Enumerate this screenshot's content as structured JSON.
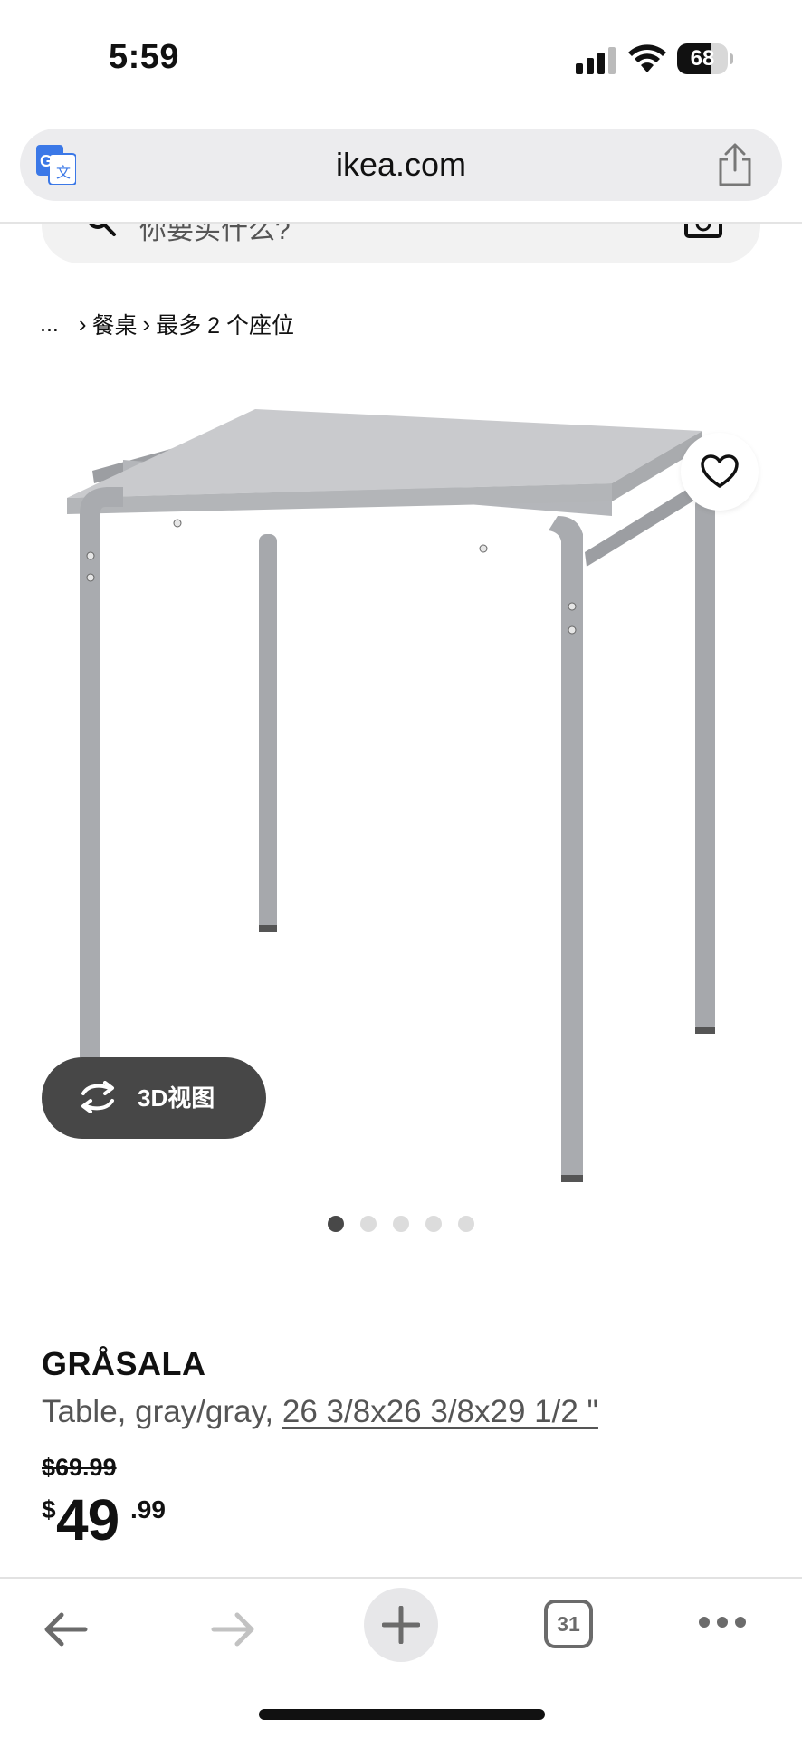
{
  "status_bar": {
    "time": "5:59",
    "battery": "68",
    "battery_level_percent": 68
  },
  "browser": {
    "url": "ikea.com",
    "tab_count": "31"
  },
  "search": {
    "placeholder": "你要买什么?"
  },
  "breadcrumb": {
    "ellipsis": "...",
    "items": [
      "餐桌",
      "最多 2 个座位"
    ]
  },
  "gallery": {
    "view_3d_label": "3D视图",
    "image_count": 5,
    "active_index": 0
  },
  "product": {
    "name": "GRÅSALA",
    "description": "Table, gray/gray,",
    "dimensions": "26 3/8x26 3/8x29 1/2 \"",
    "old_price": "$69.99",
    "price_currency": "$",
    "price_integer": "49",
    "price_decimal": ".99"
  },
  "icons": {
    "translate": "translate-icon",
    "share": "share-icon",
    "search": "search-icon",
    "camera": "camera-icon",
    "favorite": "heart-icon",
    "rotate": "rotate-3d-icon",
    "back": "back-arrow-icon",
    "forward": "forward-arrow-icon",
    "new_tab": "plus-icon",
    "more": "more-icon"
  },
  "colors": {
    "dark_button": "#474747",
    "url_bar": "#ececee",
    "text_secondary": "#555555",
    "active_dot": "#484848",
    "inactive_dot": "#dcdcdc"
  }
}
